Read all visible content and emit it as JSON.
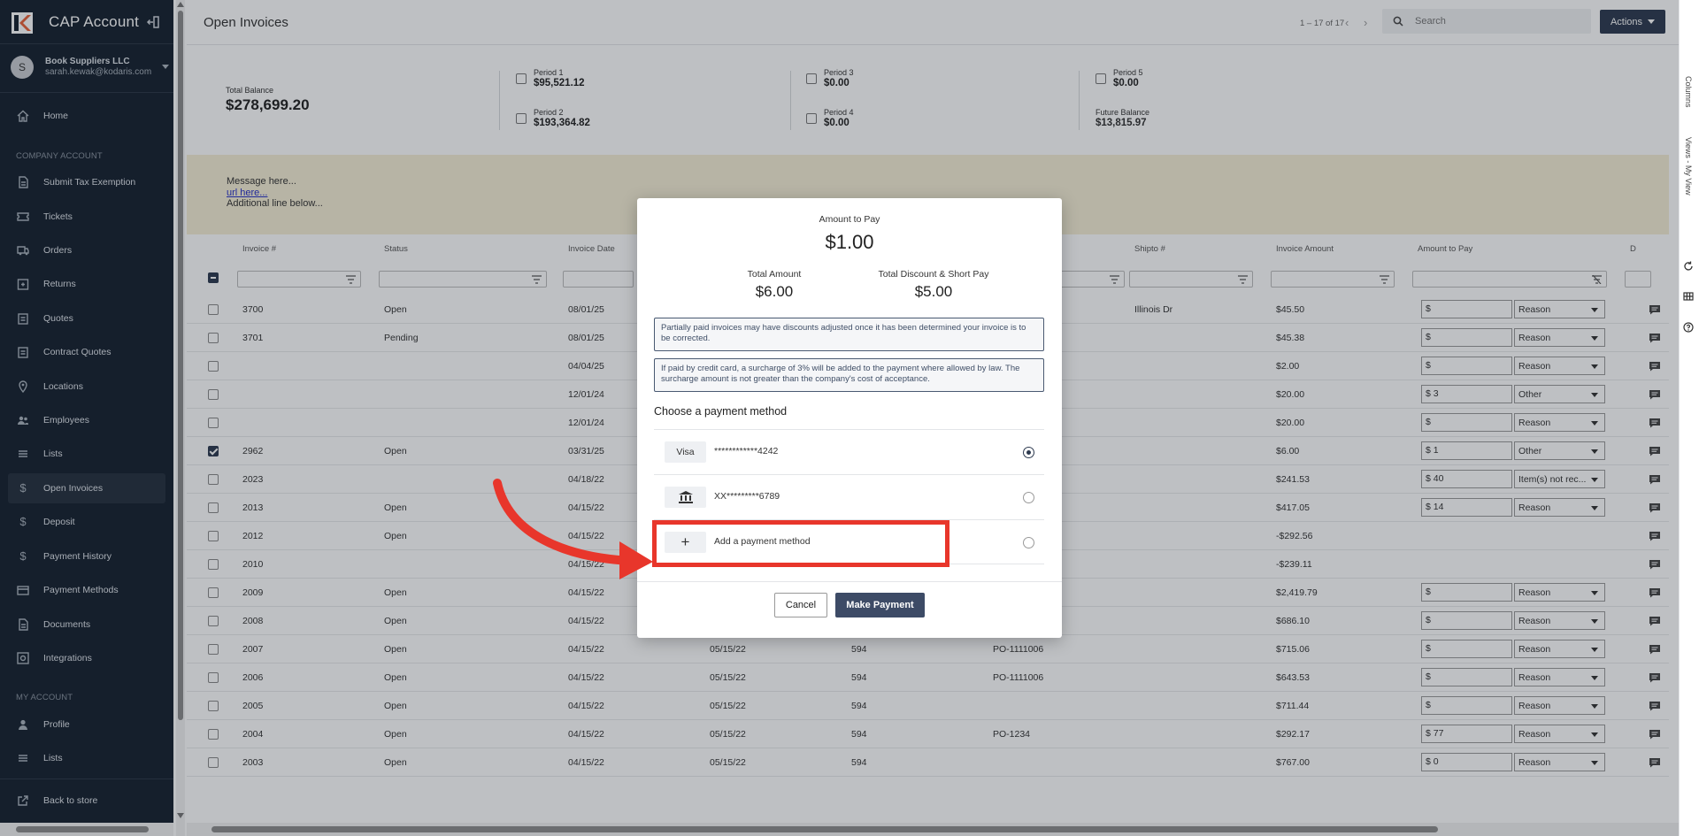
{
  "app": {
    "title": "CAP Account"
  },
  "user": {
    "initial": "S",
    "company": "Book Suppliers LLC",
    "email": "sarah.kewak@kodaris.com"
  },
  "sidebar": {
    "section_company": "COMPANY ACCOUNT",
    "section_my": "MY ACCOUNT",
    "items": [
      {
        "label": "Home",
        "icon": "home-icon"
      },
      {
        "label": "Submit Tax Exemption",
        "icon": "document-icon"
      },
      {
        "label": "Tickets",
        "icon": "ticket-icon"
      },
      {
        "label": "Orders",
        "icon": "truck-icon"
      },
      {
        "label": "Returns",
        "icon": "return-icon"
      },
      {
        "label": "Quotes",
        "icon": "clipboard-icon"
      },
      {
        "label": "Contract Quotes",
        "icon": "clipboard-icon"
      },
      {
        "label": "Locations",
        "icon": "pin-icon"
      },
      {
        "label": "Employees",
        "icon": "people-icon"
      },
      {
        "label": "Lists",
        "icon": "list-icon"
      },
      {
        "label": "Open Invoices",
        "icon": "dollar-icon"
      },
      {
        "label": "Deposit",
        "icon": "dollar-icon"
      },
      {
        "label": "Payment History",
        "icon": "dollar-icon"
      },
      {
        "label": "Payment Methods",
        "icon": "card-icon"
      },
      {
        "label": "Documents",
        "icon": "document-icon"
      },
      {
        "label": "Integrations",
        "icon": "integration-icon"
      }
    ],
    "my_items": [
      {
        "label": "Profile",
        "icon": "person-icon"
      },
      {
        "label": "Lists",
        "icon": "list-icon"
      }
    ],
    "back_to_store": "Back to store"
  },
  "header": {
    "title": "Open Invoices",
    "pager": "1 – 17 of 17",
    "search_placeholder": "Search",
    "actions_label": "Actions"
  },
  "summary": {
    "total_balance_label": "Total Balance",
    "total_balance": "$278,699.20",
    "periods": [
      {
        "label": "Period 1",
        "value": "$95,521.12"
      },
      {
        "label": "Period 2",
        "value": "$193,364.82"
      },
      {
        "label": "Period 3",
        "value": "$0.00"
      },
      {
        "label": "Period 4",
        "value": "$0.00"
      },
      {
        "label": "Period 5",
        "value": "$0.00"
      }
    ],
    "future_balance_label": "Future Balance",
    "future_balance": "$13,815.97"
  },
  "message": {
    "line1": "Message here...",
    "link": "url here...",
    "line3": "Additional line below..."
  },
  "table": {
    "headers": [
      "Invoice #",
      "Status",
      "Invoice Date",
      "Shipto #",
      "Invoice Amount",
      "Amount to Pay",
      "D"
    ],
    "rows": [
      {
        "invoice": "3700",
        "status": "Open",
        "date": "08/01/25",
        "due": "",
        "customer": "",
        "po": "",
        "shipto": "Illinois Dr",
        "amount": "$45.50",
        "pay": "$",
        "reason": "Reason",
        "checked": false,
        "has_pay": true
      },
      {
        "invoice": "3701",
        "status": "Pending",
        "date": "08/01/25",
        "due": "",
        "customer": "",
        "po": "",
        "shipto": "",
        "amount": "$45.38",
        "pay": "$",
        "reason": "Reason",
        "checked": false,
        "has_pay": true
      },
      {
        "invoice": "",
        "status": "",
        "date": "04/04/25",
        "due": "",
        "customer": "",
        "po": "",
        "shipto": "",
        "amount": "$2.00",
        "pay": "$",
        "reason": "Reason",
        "checked": false,
        "has_pay": true
      },
      {
        "invoice": "",
        "status": "",
        "date": "12/01/24",
        "due": "",
        "customer": "",
        "po": "",
        "shipto": "",
        "amount": "$20.00",
        "pay": "$ 3",
        "reason": "Other",
        "checked": false,
        "has_pay": true
      },
      {
        "invoice": "",
        "status": "",
        "date": "12/01/24",
        "due": "",
        "customer": "",
        "po": "",
        "shipto": "",
        "amount": "$20.00",
        "pay": "$",
        "reason": "Reason",
        "checked": false,
        "has_pay": true
      },
      {
        "invoice": "2962",
        "status": "Open",
        "date": "03/31/25",
        "due": "",
        "customer": "",
        "po": "",
        "shipto": "",
        "amount": "$6.00",
        "pay": "$ 1",
        "reason": "Other",
        "checked": true,
        "has_pay": true
      },
      {
        "invoice": "2023",
        "status": "",
        "date": "04/18/22",
        "due": "",
        "customer": "",
        "po": "",
        "shipto": "",
        "amount": "$241.53",
        "pay": "$ 40",
        "reason": "Item(s) not rec...",
        "checked": false,
        "has_pay": true
      },
      {
        "invoice": "2013",
        "status": "Open",
        "date": "04/15/22",
        "due": "",
        "customer": "",
        "po": "",
        "shipto": "",
        "amount": "$417.05",
        "pay": "$ 14",
        "reason": "Reason",
        "checked": false,
        "has_pay": true
      },
      {
        "invoice": "2012",
        "status": "Open",
        "date": "04/15/22",
        "due": "",
        "customer": "",
        "po": "",
        "shipto": "",
        "amount": "-$292.56",
        "pay": "",
        "reason": "",
        "checked": false,
        "has_pay": false
      },
      {
        "invoice": "2010",
        "status": "",
        "date": "04/15/22",
        "due": "",
        "customer": "",
        "po": "",
        "shipto": "",
        "amount": "-$239.11",
        "pay": "",
        "reason": "",
        "checked": false,
        "has_pay": false
      },
      {
        "invoice": "2009",
        "status": "Open",
        "date": "04/15/22",
        "due": "",
        "customer": "",
        "po": "",
        "shipto": "",
        "amount": "$2,419.79",
        "pay": "$",
        "reason": "Reason",
        "checked": false,
        "has_pay": true
      },
      {
        "invoice": "2008",
        "status": "Open",
        "date": "04/15/22",
        "due": "",
        "customer": "",
        "po": "",
        "shipto": "",
        "amount": "$686.10",
        "pay": "$",
        "reason": "Reason",
        "checked": false,
        "has_pay": true
      },
      {
        "invoice": "2007",
        "status": "Open",
        "date": "04/15/22",
        "due": "05/15/22",
        "customer": "594",
        "po": "PO-1111006",
        "shipto": "",
        "amount": "$715.06",
        "pay": "$",
        "reason": "Reason",
        "checked": false,
        "has_pay": true
      },
      {
        "invoice": "2006",
        "status": "Open",
        "date": "04/15/22",
        "due": "05/15/22",
        "customer": "594",
        "po": "PO-1111006",
        "shipto": "",
        "amount": "$643.53",
        "pay": "$",
        "reason": "Reason",
        "checked": false,
        "has_pay": true
      },
      {
        "invoice": "2005",
        "status": "Open",
        "date": "04/15/22",
        "due": "05/15/22",
        "customer": "594",
        "po": "",
        "shipto": "",
        "amount": "$711.44",
        "pay": "$",
        "reason": "Reason",
        "checked": false,
        "has_pay": true
      },
      {
        "invoice": "2004",
        "status": "Open",
        "date": "04/15/22",
        "due": "05/15/22",
        "customer": "594",
        "po": "PO-1234",
        "shipto": "",
        "amount": "$292.17",
        "pay": "$ 77",
        "reason": "Reason",
        "checked": false,
        "has_pay": true
      },
      {
        "invoice": "2003",
        "status": "Open",
        "date": "04/15/22",
        "due": "05/15/22",
        "customer": "594",
        "po": "",
        "shipto": "",
        "amount": "$767.00",
        "pay": "$ 0",
        "reason": "Reason",
        "checked": false,
        "has_pay": true
      }
    ]
  },
  "right_rail": {
    "columns": "Columns",
    "views": "Views - My View"
  },
  "modal": {
    "amount_to_pay_label": "Amount to Pay",
    "amount_to_pay": "$1.00",
    "total_amount_label": "Total Amount",
    "total_amount": "$6.00",
    "discount_label": "Total Discount & Short Pay",
    "discount": "$5.00",
    "notice1": "Partially paid invoices may have discounts adjusted once it has been determined your invoice is to be corrected.",
    "notice2": "If paid by credit card, a surcharge of 3% will be added to the payment where allowed by law. The surcharge amount is not greater than the company's cost of acceptance.",
    "choose_label": "Choose a payment method",
    "methods": [
      {
        "badge": "Visa",
        "label": "************4242",
        "selected": true
      },
      {
        "badge": "",
        "label": "XX*********6789",
        "selected": false
      },
      {
        "badge": "+",
        "label": "Add a payment method",
        "selected": false
      }
    ],
    "cancel_label": "Cancel",
    "pay_label": "Make Payment"
  },
  "colors": {
    "sidebar": "#15202e",
    "accent": "#2d3a4f",
    "annotation": "#e8362b",
    "message_bg": "#f6efd6"
  }
}
